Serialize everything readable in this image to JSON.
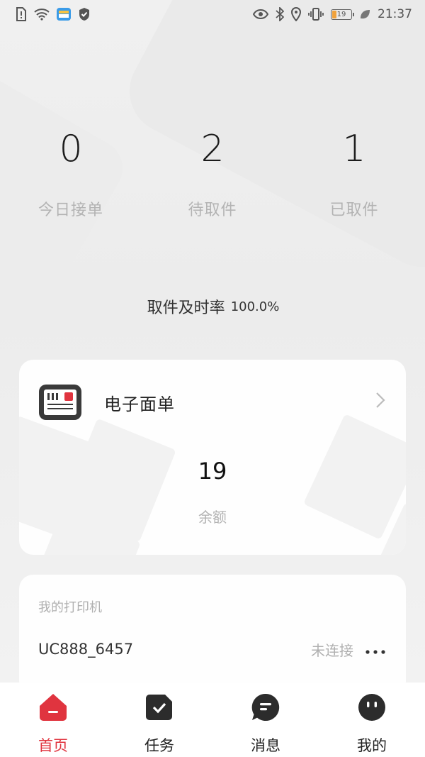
{
  "status_bar": {
    "time": "21:37",
    "battery": "19"
  },
  "stats": [
    {
      "value": "0",
      "label": "今日接单"
    },
    {
      "value": "2",
      "label": "待取件"
    },
    {
      "value": "1",
      "label": "已取件"
    }
  ],
  "pickup_rate": {
    "label": "取件及时率",
    "value": "100.0%"
  },
  "waybill": {
    "title": "电子面单",
    "balance": "19",
    "balance_label": "余额"
  },
  "printer": {
    "section_title": "我的打印机",
    "name": "UC888_6457",
    "status": "未连接"
  },
  "tabs": [
    {
      "label": "首页",
      "icon": "home-icon",
      "active": true
    },
    {
      "label": "任务",
      "icon": "task-check-icon",
      "active": false
    },
    {
      "label": "消息",
      "icon": "message-icon",
      "active": false
    },
    {
      "label": "我的",
      "icon": "profile-icon",
      "active": false
    }
  ],
  "colors": {
    "accent": "#e0343f",
    "dark_icon": "#2c2c2c"
  }
}
